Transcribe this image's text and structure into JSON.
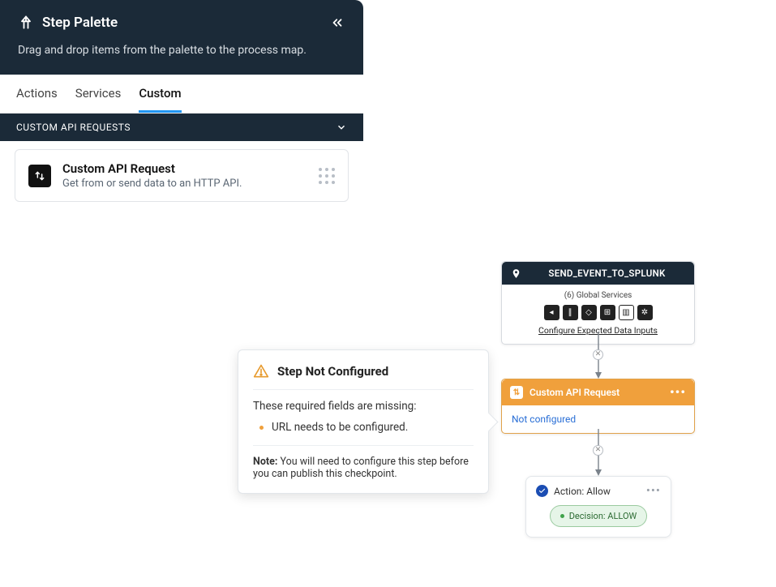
{
  "sidebar": {
    "title": "Step Palette",
    "subtitle": "Drag and drop items from the palette to the process map.",
    "tabs": [
      "Actions",
      "Services",
      "Custom"
    ],
    "active_tab": "Custom",
    "category": "CUSTOM API REQUESTS",
    "card": {
      "title": "Custom API Request",
      "desc": "Get from or send data to an HTTP API."
    }
  },
  "start_node": {
    "title": "SEND_EVENT_TO_SPLUNK",
    "providers": "(6) Global Services",
    "link": "Configure Expected Data Inputs"
  },
  "api_node": {
    "title": "Custom API Request",
    "status": "Not configured"
  },
  "allow_node": {
    "title": "Action: Allow",
    "decision": "Decision: ALLOW"
  },
  "callout": {
    "title": "Step Not Configured",
    "message": "These required fields are missing:",
    "items": [
      "URL needs to be configured."
    ],
    "note_label": "Note:",
    "note": "You will need to configure this step before you can publish this checkpoint."
  }
}
